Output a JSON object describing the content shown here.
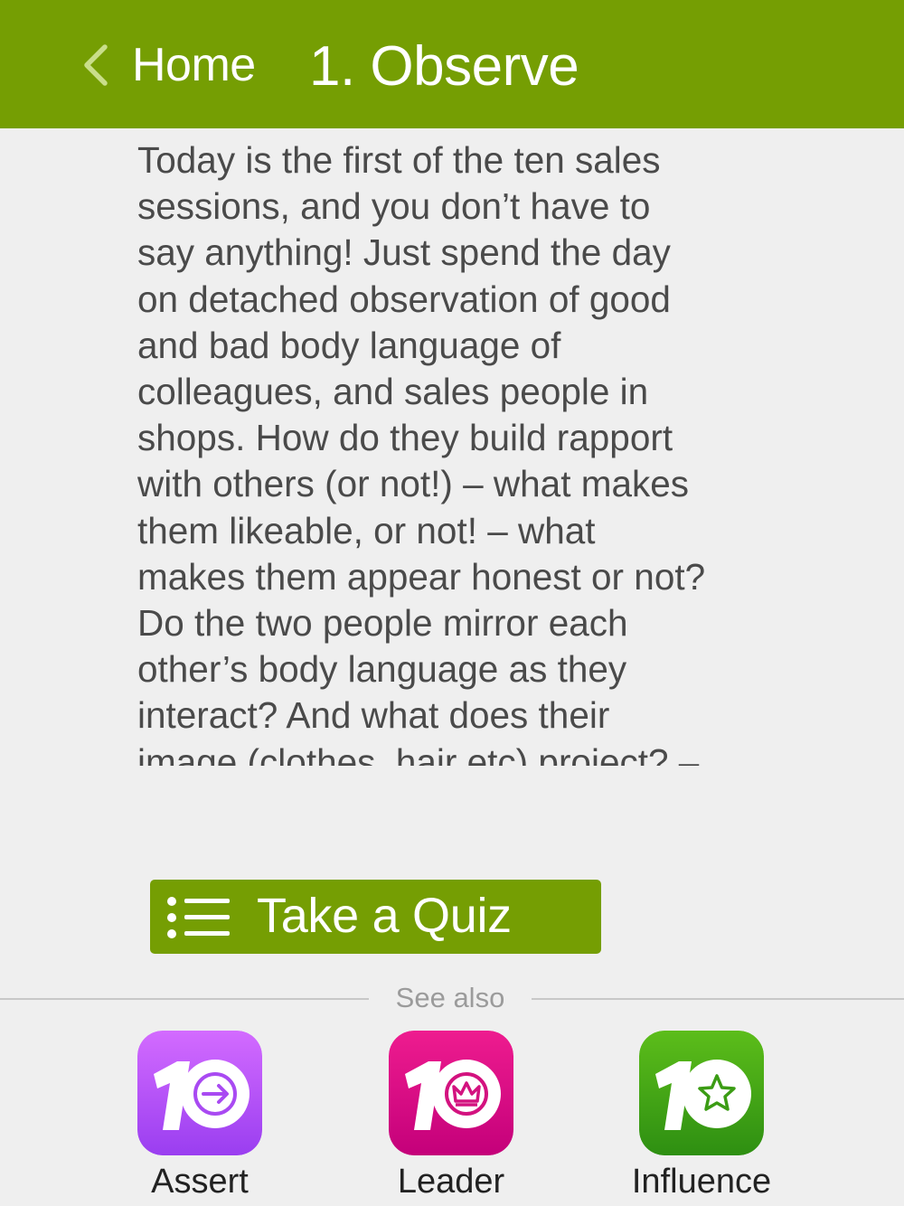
{
  "header": {
    "back_label": "Home",
    "title": "1. Observe",
    "background_color": "#759e03"
  },
  "content": {
    "text": "Today is the first of the ten sales\nsessions, and you don’t have to\nsay anything!  Just spend the day\non detached observation of good\nand bad body language of\ncolleagues, and sales people in\nshops.  How do they build rapport\nwith others (or not!) – what makes\nthem likeable, or not! – what\nmakes them appear honest or not?\nDo the two people mirror each\nother’s body language as they\ninteract?  And what does their\nimage (clothes, hair etc) project? –"
  },
  "quiz": {
    "label": "Take a Quiz",
    "icon": "list-icon"
  },
  "see_also": {
    "label": "See also",
    "apps": [
      {
        "label": "Assert",
        "icon": "arrow-circle-icon",
        "color_top": "#d36bff",
        "color_bottom": "#9a3ef0"
      },
      {
        "label": "Leader",
        "icon": "crown-circle-icon",
        "color_top": "#ee1c8f",
        "color_bottom": "#c4007a"
      },
      {
        "label": "Influence",
        "icon": "star-circle-icon",
        "color_top": "#5cbd1a",
        "color_bottom": "#2e8f12"
      }
    ]
  }
}
